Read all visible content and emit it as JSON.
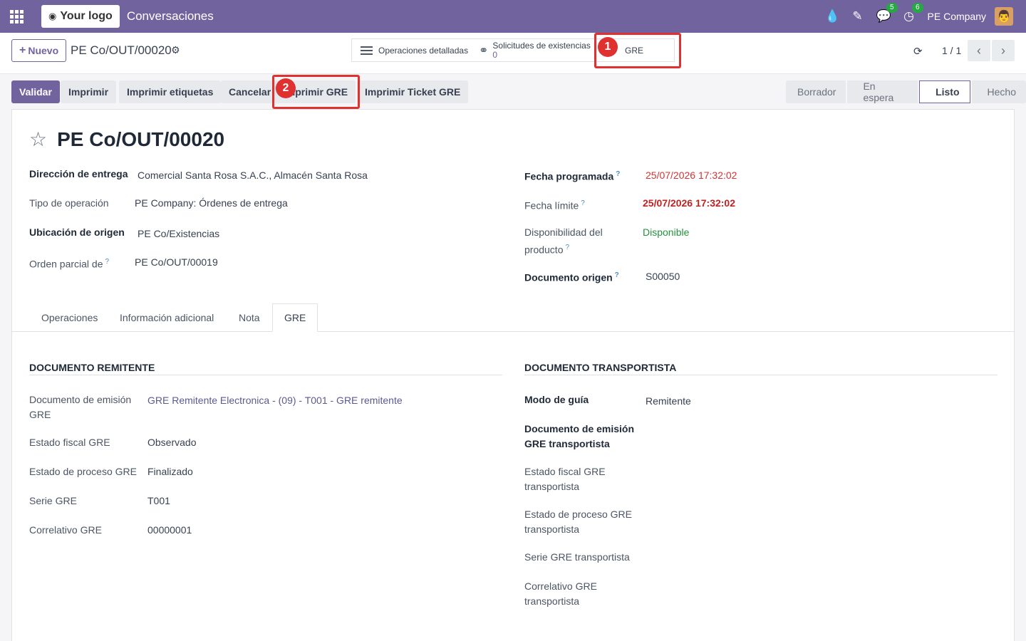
{
  "navbar": {
    "logo_text": "Your logo",
    "app_name": "Conversaciones",
    "messages_badge": "5",
    "activities_badge": "6",
    "company": "PE Company"
  },
  "control": {
    "new_label": "Nuevo",
    "breadcrumb": "PE Co/OUT/00020",
    "smart_ops": "Operaciones detalladas",
    "smart_req_label": "Solicitudes de existencias",
    "smart_req_count": "0",
    "smart_gre": "GRE",
    "pager": "1 / 1"
  },
  "annotations": [
    "1",
    "2"
  ],
  "actions": {
    "validar": "Validar",
    "imprimir": "Imprimir",
    "imprimir_etiquetas": "Imprimir etiquetas",
    "cancelar": "Cancelar",
    "imprimir_gre": "Imprimir GRE",
    "imprimir_ticket_gre": "Imprimir Ticket GRE"
  },
  "status": [
    "Borrador",
    "En espera",
    "Listo",
    "Hecho"
  ],
  "record": {
    "title": "PE Co/OUT/00020",
    "left": [
      {
        "label": "Dirección de entrega",
        "value": "Comercial Santa Rosa S.A.C., Almacén Santa Rosa"
      },
      {
        "label": "Tipo de operación",
        "value": "PE Company: Órdenes de entrega"
      },
      {
        "label": "Ubicación de origen",
        "value": "PE Co/Existencias"
      },
      {
        "label": "Orden parcial de",
        "value": "PE Co/OUT/00019"
      }
    ],
    "right": [
      {
        "label": "Fecha programada",
        "value": "25/07/2026 17:32:02"
      },
      {
        "label": "Fecha límite",
        "value": "25/07/2026 17:32:02"
      },
      {
        "label": "Disponibilidad del producto",
        "value": "Disponible"
      },
      {
        "label": "Documento origen",
        "value": "S00050"
      }
    ]
  },
  "tabs": [
    "Operaciones",
    "Información adicional",
    "Nota",
    "GRE"
  ],
  "gre": {
    "remitente_title": "DOCUMENTO REMITENTE",
    "remitente": [
      {
        "label": "Documento de emisión GRE",
        "value": "GRE Remitente Electronica - (09) - T001 - GRE remitente"
      },
      {
        "label": "Estado fiscal GRE",
        "value": "Observado"
      },
      {
        "label": "Estado de proceso GRE",
        "value": "Finalizado"
      },
      {
        "label": "Serie GRE",
        "value": "T001"
      },
      {
        "label": "Correlativo GRE",
        "value": "00000001"
      }
    ],
    "transportista_title": "DOCUMENTO TRANSPORTISTA",
    "transportista": [
      {
        "label": "Modo de guía",
        "value": "Remitente"
      },
      {
        "label": "Documento de emisión GRE transportista",
        "value": ""
      },
      {
        "label": "Estado fiscal GRE transportista",
        "value": ""
      },
      {
        "label": "Estado de proceso GRE transportista",
        "value": ""
      },
      {
        "label": "Serie GRE transportista",
        "value": ""
      },
      {
        "label": "Correlativo GRE transportista",
        "value": ""
      }
    ]
  }
}
